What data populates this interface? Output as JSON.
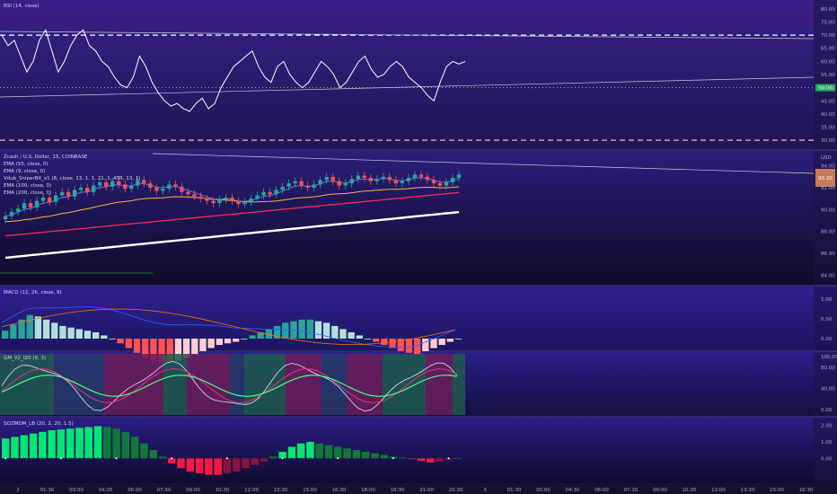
{
  "panes": {
    "rsi": {
      "title": "RSI (14, close)",
      "ticks": [
        "80.00",
        "75.00",
        "70.00",
        "65.00",
        "60.00",
        "55.00",
        "50.00",
        "45.00",
        "40.00",
        "35.00",
        "30.00"
      ],
      "tick_values": [
        80,
        75,
        70,
        65,
        60,
        55,
        50,
        45,
        40,
        35,
        30
      ],
      "ylim": [
        28,
        82
      ],
      "current_value": "50.00",
      "series": [
        70,
        66,
        68,
        62,
        56,
        60,
        68,
        72,
        64,
        56,
        60,
        66,
        70,
        72,
        66,
        64,
        60,
        58,
        54,
        51,
        50,
        54,
        62,
        58,
        52,
        48,
        45,
        43,
        44,
        42,
        41,
        44,
        46,
        42,
        44,
        50,
        54,
        58,
        60,
        62,
        64,
        58,
        54,
        52,
        58,
        60,
        55,
        52,
        50,
        52,
        56,
        60,
        58,
        55,
        50,
        52,
        56,
        60,
        62,
        57,
        54,
        55,
        58,
        60,
        58,
        54,
        52,
        50,
        47,
        45,
        52,
        58,
        60,
        59,
        60
      ],
      "colors": {
        "bg_top": "#3a1f86",
        "bg_bottom": "#1b1350",
        "line": "#ffffff"
      }
    },
    "price": {
      "title": "Zcash / U.S. Dollar, 15, COINBASE",
      "legend": [
        "EMA (55, close, 0)",
        "EMA (9, close, 0)",
        "Vdub_SniperBX_v1 (8, close, 13, 1, 1, 21, 1, ATR, 13, 1)",
        "EMA (100, close, 0)",
        "EMA (200, close, 0)"
      ],
      "unit": "USD",
      "ticks": [
        "94.00",
        "92.00",
        "90.00",
        "88.00",
        "86.00",
        "84.00"
      ],
      "tick_values": [
        94,
        92,
        90,
        88,
        86,
        84
      ],
      "ylim": [
        83.3,
        95.2
      ],
      "current_price": "93.20",
      "candles": [
        89.4,
        89.8,
        90.1,
        90.6,
        90.2,
        90.8,
        91.1,
        90.7,
        91.3,
        91.6,
        91.2,
        91.8,
        92.0,
        91.6,
        92.2,
        92.5,
        92.1,
        92.6,
        92.3,
        91.9,
        92.2,
        92.7,
        92.4,
        92.0,
        91.7,
        91.9,
        92.3,
        92.1,
        91.6,
        91.4,
        91.2,
        91.0,
        90.8,
        90.6,
        90.9,
        91.1,
        90.8,
        90.5,
        90.7,
        91.0,
        91.3,
        91.6,
        91.4,
        91.8,
        92.1,
        92.4,
        92.6,
        92.2,
        92.0,
        92.3,
        92.7,
        93.0,
        92.6,
        92.2,
        92.4,
        92.8,
        93.1,
        92.9,
        92.6,
        92.8,
        93.0,
        92.7,
        92.4,
        92.6,
        92.9,
        93.2,
        93.0,
        92.7,
        92.4,
        92.2,
        92.5,
        92.9,
        93.2
      ],
      "colors": {
        "up": "#26a69a",
        "down": "#ef5350",
        "ema9": "#ffb13b",
        "ema55": "#e040fb",
        "ema100": "#ff2a55",
        "ema200": "#ffffff"
      }
    },
    "macd": {
      "title": "MACD (12, 26, close, 9)",
      "ticks": [
        "1.00",
        "0.50",
        "0.00"
      ],
      "tick_values": [
        1.0,
        0.5,
        0.0
      ],
      "ylim": [
        -0.25,
        1.25
      ],
      "hist": [
        0.05,
        0.09,
        0.12,
        0.15,
        0.14,
        0.12,
        0.1,
        0.08,
        0.07,
        0.06,
        0.05,
        0.04,
        0.02,
        0.0,
        -0.03,
        -0.06,
        -0.09,
        -0.12,
        -0.14,
        -0.15,
        -0.15,
        -0.14,
        -0.12,
        -0.1,
        -0.08,
        -0.06,
        -0.04,
        -0.03,
        -0.02,
        0.0,
        0.02,
        0.04,
        0.06,
        0.08,
        0.1,
        0.11,
        0.12,
        0.12,
        0.11,
        0.1,
        0.08,
        0.06,
        0.04,
        0.02,
        0.0,
        -0.02,
        -0.04,
        -0.06,
        -0.08,
        -0.09,
        -0.1,
        -0.08,
        -0.06,
        -0.04,
        -0.02,
        0.0
      ]
    },
    "gm": {
      "title": "GM_V2_IZ0 (9, 3)",
      "ticks": [
        "100.00",
        "80.00",
        "40.00",
        "0.00"
      ],
      "tick_values": [
        100,
        80,
        40,
        0
      ],
      "ylim": [
        -10,
        105
      ]
    },
    "sqz": {
      "title": "SQZMOM_LB (20, 2, 20, 1.5)",
      "ticks": [
        "2.00",
        "1.00",
        "0.00"
      ],
      "tick_values": [
        2.0,
        1.0,
        0.0
      ],
      "ylim": [
        -1.4,
        2.3
      ],
      "values": [
        1.2,
        1.3,
        1.4,
        1.5,
        1.6,
        1.7,
        1.75,
        1.8,
        1.85,
        1.9,
        1.95,
        1.9,
        1.8,
        1.6,
        1.3,
        0.9,
        0.5,
        0.1,
        -0.3,
        -0.6,
        -0.8,
        -0.9,
        -1.0,
        -1.0,
        -0.9,
        -0.8,
        -0.6,
        -0.4,
        -0.2,
        0.1,
        0.4,
        0.7,
        0.9,
        1.0,
        0.9,
        0.8,
        0.7,
        0.6,
        0.5,
        0.4,
        0.3,
        0.2,
        0.1,
        0.05,
        -0.05,
        -0.15,
        -0.25,
        -0.2,
        -0.1,
        0.0
      ]
    }
  },
  "time_axis": {
    "labels": [
      "2",
      "01:30",
      "03:00",
      "04:30",
      "06:00",
      "07:30",
      "09:00",
      "10:30",
      "12:00",
      "13:30",
      "15:00",
      "16:30",
      "18:00",
      "19:30",
      "21:00",
      "22:30",
      "3",
      "01:30",
      "03:00",
      "04:30",
      "06:00",
      "07:30",
      "09:00",
      "10:30",
      "12:00",
      "13:30",
      "15:00",
      "16:30"
    ]
  }
}
